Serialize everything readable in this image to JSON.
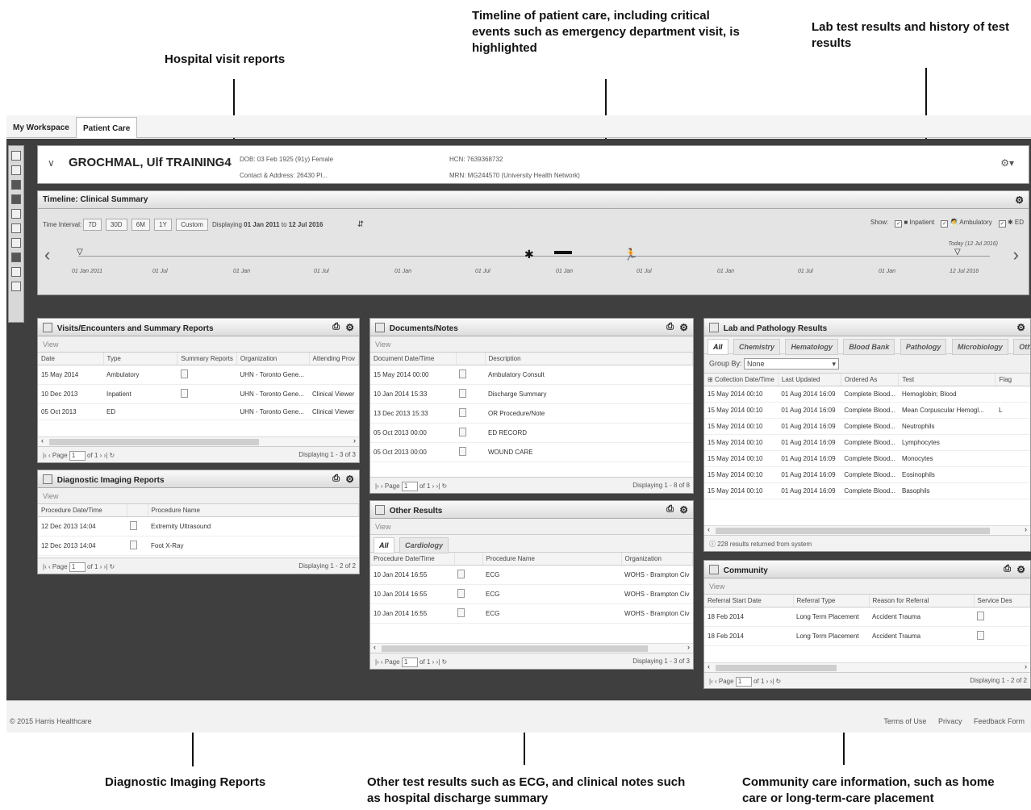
{
  "callouts": {
    "visits": "Hospital visit reports",
    "timeline": "Timeline of patient care, including critical events such as emergency department visit, is highlighted",
    "lab": "Lab test results and history of test results",
    "imaging": "Diagnostic Imaging Reports",
    "other": "Other test results such as ECG, and clinical notes such as hospital discharge summary",
    "community": "Community care information, such as home care or long-term-care placement"
  },
  "tabs": [
    "My Workspace",
    "Patient Care"
  ],
  "patient": {
    "name": "GROCHMAL, Ulf TRAINING4",
    "dob": "DOB: 03 Feb 1925 (91y) Female",
    "contact": "Contact & Address: 26430 Pl...",
    "hcn": "HCN: 7639368732",
    "mrn": "MRN: MG244570 (University Health Network)"
  },
  "timeline": {
    "title": "Timeline: Clinical Summary",
    "interval_label": "Time Interval:",
    "buttons": [
      "7D",
      "30D",
      "6M",
      "1Y",
      "Custom"
    ],
    "displaying_prefix": "Displaying",
    "from": "01 Jan 2011",
    "to_word": "to",
    "to": "12 Jul 2016",
    "show_label": "Show:",
    "legend": [
      "Inpatient",
      "Ambulatory",
      "ED"
    ],
    "today": "Today (12 Jul 2016)",
    "ticks": [
      "01 Jan 2011",
      "01 Jul",
      "01 Jan",
      "01 Jul",
      "01 Jan",
      "01 Jul",
      "01 Jan",
      "01 Jul",
      "01 Jan",
      "01 Jul",
      "01 Jan",
      "12 Jul 2016"
    ]
  },
  "visits": {
    "title": "Visits/Encounters and Summary Reports",
    "view": "View",
    "columns": [
      "Date",
      "Type",
      "Summary Reports",
      "Organization",
      "Attending Prov"
    ],
    "rows": [
      [
        "15 May 2014",
        "Ambulatory",
        "UHN - Toronto Gene...",
        ""
      ],
      [
        "10 Dec 2013",
        "Inpatient",
        "UHN - Toronto Gene...",
        "Clinical Viewer"
      ],
      [
        "05 Oct 2013",
        "ED",
        "UHN - Toronto Gene...",
        "Clinical Viewer"
      ]
    ],
    "page_label": "Page",
    "page": "1",
    "of": "of 1",
    "displaying": "Displaying 1 - 3 of 3"
  },
  "imaging": {
    "title": "Diagnostic Imaging Reports",
    "view": "View",
    "columns": [
      "Procedure Date/Time",
      "",
      "Procedure Name"
    ],
    "rows": [
      [
        "12 Dec 2013 14:04",
        "Extremity Ultrasound"
      ],
      [
        "12 Dec 2013 14:04",
        "Foot X-Ray"
      ]
    ],
    "page_label": "Page",
    "page": "1",
    "of": "of 1",
    "displaying": "Displaying 1 - 2 of 2"
  },
  "documents": {
    "title": "Documents/Notes",
    "view": "View",
    "columns": [
      "Document Date/Time",
      "",
      "Description"
    ],
    "rows": [
      [
        "15 May 2014 00:00",
        "Ambulatory Consult"
      ],
      [
        "10 Jan 2014 15:33",
        "Discharge Summary"
      ],
      [
        "13 Dec 2013 15:33",
        "OR Procedure/Note"
      ],
      [
        "05 Oct 2013 00:00",
        "ED RECORD"
      ],
      [
        "05 Oct 2013 00:00",
        "WOUND CARE"
      ]
    ],
    "page_label": "Page",
    "page": "1",
    "of": "of 1",
    "displaying": "Displaying 1 - 8 of 8"
  },
  "other": {
    "title": "Other Results",
    "view": "View",
    "subtabs": [
      "All",
      "Cardiology"
    ],
    "columns": [
      "Procedure Date/Time",
      "",
      "Procedure Name",
      "Organization"
    ],
    "rows": [
      [
        "10 Jan 2014 16:55",
        "ECG",
        "WOHS - Brampton Civ"
      ],
      [
        "10 Jan 2014 16:55",
        "ECG",
        "WOHS - Brampton Civ"
      ],
      [
        "10 Jan 2014 16:55",
        "ECG",
        "WOHS - Brampton Civ"
      ]
    ],
    "page_label": "Page",
    "page": "1",
    "of": "of 1",
    "displaying": "Displaying 1 - 3 of 3"
  },
  "lab": {
    "title": "Lab and Pathology Results",
    "subtabs": [
      "All",
      "Chemistry",
      "Hematology",
      "Blood Bank",
      "Pathology",
      "Microbiology",
      "Other"
    ],
    "group_label": "Group By:",
    "group_value": "None",
    "columns": [
      "Collection Date/Time",
      "Last Updated",
      "Ordered As",
      "Test",
      "Flag"
    ],
    "rows": [
      [
        "15 May 2014 00:10",
        "01 Aug 2014 16:09",
        "Complete Blood...",
        "Hemoglobin; Blood",
        ""
      ],
      [
        "15 May 2014 00:10",
        "01 Aug 2014 16:09",
        "Complete Blood...",
        "Mean Corpuscular Hemogl...",
        "L"
      ],
      [
        "15 May 2014 00:10",
        "01 Aug 2014 16:09",
        "Complete Blood...",
        "Neutrophils",
        ""
      ],
      [
        "15 May 2014 00:10",
        "01 Aug 2014 16:09",
        "Complete Blood...",
        "Lymphocytes",
        ""
      ],
      [
        "15 May 2014 00:10",
        "01 Aug 2014 16:09",
        "Complete Blood...",
        "Monocytes",
        ""
      ],
      [
        "15 May 2014 00:10",
        "01 Aug 2014 16:09",
        "Complete Blood...",
        "Eosinophils",
        ""
      ],
      [
        "15 May 2014 00:10",
        "01 Aug 2014 16:09",
        "Complete Blood...",
        "Basophils",
        ""
      ]
    ],
    "status": "228 results returned from system"
  },
  "community": {
    "title": "Community",
    "view": "View",
    "columns": [
      "Referral Start Date",
      "Referral Type",
      "Reason for Referral",
      "Service Des"
    ],
    "rows": [
      [
        "18 Feb 2014",
        "Long Term Placement",
        "Accident Trauma"
      ],
      [
        "18 Feb 2014",
        "Long Term Placement",
        "Accident Trauma"
      ]
    ],
    "page_label": "Page",
    "page": "1",
    "of": "of 1",
    "displaying": "Displaying 1 - 2 of 2"
  },
  "footer": {
    "copyright": "© 2015 Harris Healthcare",
    "links": [
      "Terms of Use",
      "Privacy",
      "Feedback Form"
    ]
  }
}
